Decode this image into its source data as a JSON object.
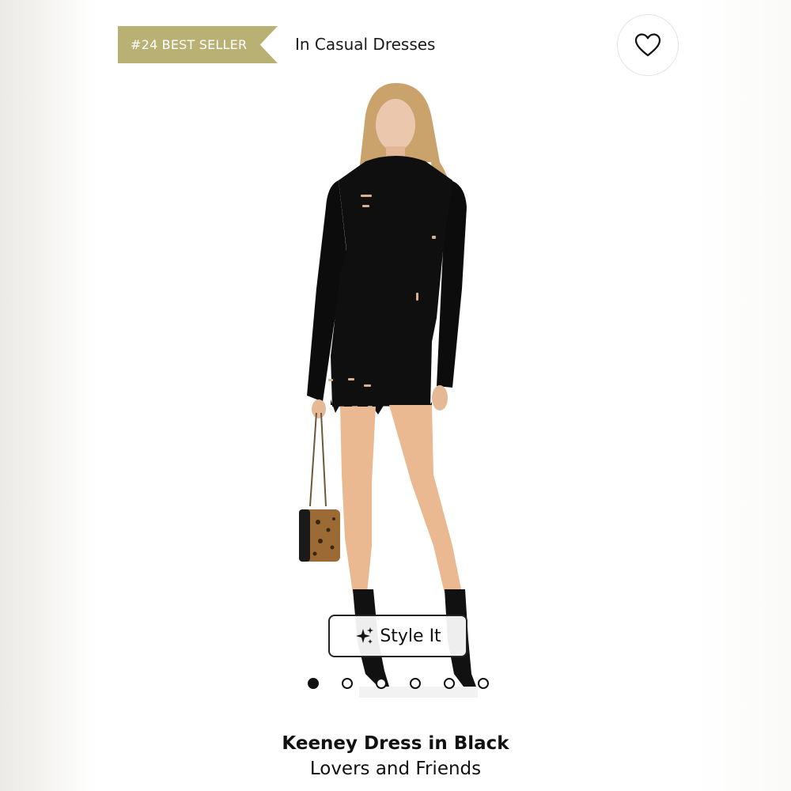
{
  "badge": {
    "text": "#24 BEST SELLER",
    "color": "#b9b174"
  },
  "category": "In Casual Dresses",
  "favorite": {
    "icon": "heart-outline-icon"
  },
  "product_image": {
    "subject": "model wearing black distressed turtleneck sweater dress with leopard print bag and black sock boots"
  },
  "style_it": {
    "label": "Style It",
    "icon": "sparkles-icon"
  },
  "carousel": {
    "total": 6,
    "active_index": 0
  },
  "product": {
    "name": "Keeney Dress in Black",
    "brand": "Lovers and Friends"
  }
}
